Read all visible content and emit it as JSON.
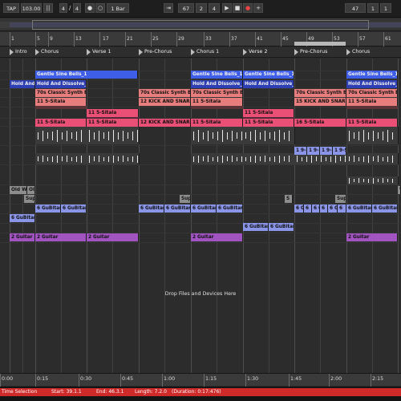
{
  "transport": {
    "tap": "TAP",
    "tempo": "103.00",
    "meter_num": "4",
    "meter_den": "4",
    "quantize": "1 Bar",
    "position": [
      "67",
      "2",
      "4"
    ],
    "loop_start": [
      "47",
      "1",
      "1"
    ]
  },
  "ruler": {
    "bars": [
      "1",
      "5",
      "9",
      "13",
      "17",
      "21",
      "25",
      "29",
      "33",
      "37",
      "41",
      "45",
      "49",
      "53",
      "57",
      "61"
    ]
  },
  "locators": [
    "Intro",
    "Chorus",
    "Verse 1",
    "Pre-Chorus",
    "Chorus 1",
    "Verse 2",
    "Pre-Chorus",
    "Chorus"
  ],
  "clips": {
    "bells": "Gentle Sine Bells_1",
    "hold": "Hold And Dissolve_1",
    "hold_partial": "Hold And Dissolve",
    "synth_bass": "70s Classic Synth Bass",
    "sitala": "11 5-Sitala",
    "kick_snare": "12 KICK AND SNARE",
    "kick_snare_15": "15 KICK AND SNARE",
    "sitala_16": "16 5-Sitala",
    "nine_s": "1 9-S",
    "old_w": "Old W",
    "old_partial": "Old",
    "sup": "Sup",
    "s": "S",
    "guitar6": "6 GuBitar 5",
    "guitar6_short": "6 GuBitar",
    "guitar6_a": "6 Gu",
    "guitar6_b": "6",
    "guitar2": "2 Guitar",
    "guitar6_verse": "6 GuBitar 5",
    "w": "W"
  },
  "drop_hint": "Drop Files and Devices Here",
  "time_ruler": [
    "0:00",
    "0:15",
    "0:30",
    "0:45",
    "1:00",
    "1:15",
    "1:30",
    "1:45",
    "2:00",
    "2:15"
  ],
  "status": {
    "label": "Time Selection",
    "start": "Start: 39.1.1",
    "end": "End: 46.3.1",
    "length": "Length: 7.2.0",
    "duration": "(Duration: 0:17:476)"
  },
  "colors": {
    "blue": "#3f5ee8",
    "salmon": "#e77d7d",
    "pink": "#ea4f76",
    "lavender": "#8b95e8",
    "purple": "#a154c0",
    "status_red": "#cf2a2a"
  }
}
